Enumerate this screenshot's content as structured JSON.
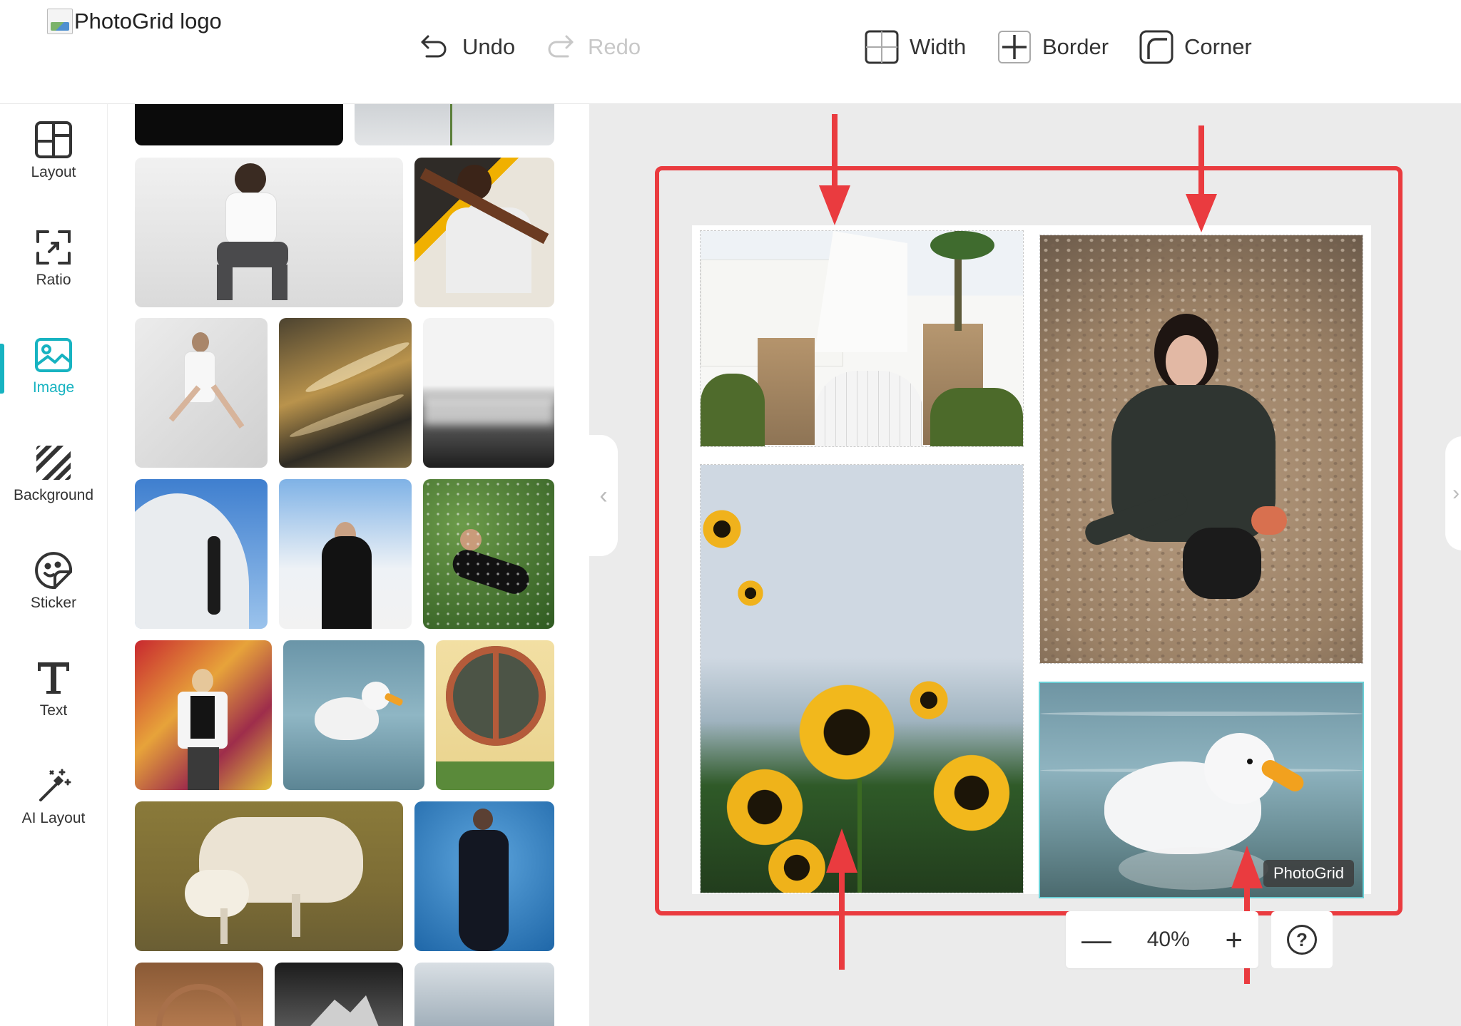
{
  "header": {
    "logo_alt": "PhotoGrid logo",
    "undo_label": "Undo",
    "redo_label": "Redo",
    "width_label": "Width",
    "border_label": "Border",
    "corner_label": "Corner"
  },
  "sidebar": {
    "items": [
      {
        "label": "Layout",
        "icon": "layout-icon",
        "active": false
      },
      {
        "label": "Ratio",
        "icon": "ratio-icon",
        "active": false
      },
      {
        "label": "Image",
        "icon": "image-icon",
        "active": true
      },
      {
        "label": "Background",
        "icon": "background-icon",
        "active": false
      },
      {
        "label": "Sticker",
        "icon": "sticker-icon",
        "active": false
      },
      {
        "label": "Text",
        "icon": "text-icon",
        "active": false
      },
      {
        "label": "AI Layout",
        "icon": "ai-layout-icon",
        "active": false
      }
    ]
  },
  "gallery": {
    "images": [
      {
        "subject": "dark photo"
      },
      {
        "subject": "cloudy sky"
      },
      {
        "subject": "man sitting on stool"
      },
      {
        "subject": "man leaning on railing"
      },
      {
        "subject": "woman posing in white dress"
      },
      {
        "subject": "ocean waves at sunset"
      },
      {
        "subject": "misty mountains"
      },
      {
        "subject": "woman by curved wall"
      },
      {
        "subject": "woman in black against sky"
      },
      {
        "subject": "woman lying in flowers"
      },
      {
        "subject": "woman by graffiti wall"
      },
      {
        "subject": "white duck on water"
      },
      {
        "subject": "round window"
      },
      {
        "subject": "sheep and lamb"
      },
      {
        "subject": "woman in black dress"
      },
      {
        "subject": "stone arch"
      },
      {
        "subject": "rocky landscape"
      },
      {
        "subject": "clouds"
      }
    ]
  },
  "canvas": {
    "cells": [
      {
        "subject": "white village houses"
      },
      {
        "subject": "sunflowers"
      },
      {
        "subject": "woman crouching on pebbles"
      },
      {
        "subject": "white duck swimming"
      }
    ],
    "watermark": "PhotoGrid",
    "colors": {
      "highlight": "#ea3b3f",
      "accent": "#17b3c1"
    }
  },
  "zoom": {
    "value": "40%",
    "minus_icon": "minus-icon",
    "plus_icon": "plus-icon"
  },
  "help": {
    "label": "?"
  }
}
